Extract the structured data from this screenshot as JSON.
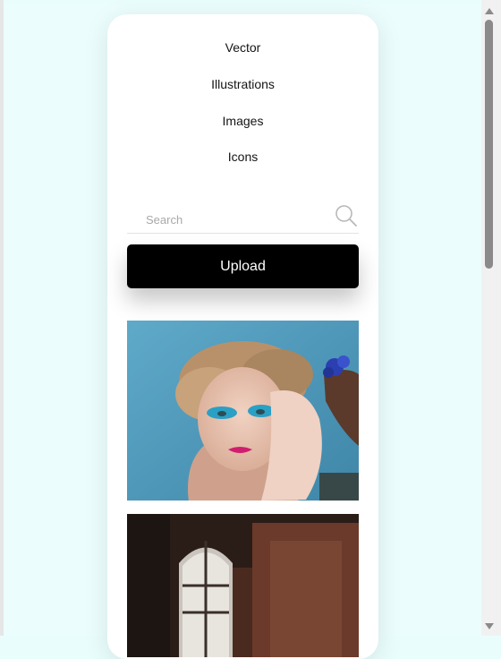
{
  "nav": {
    "items": [
      {
        "label": "Vector"
      },
      {
        "label": "Illustrations"
      },
      {
        "label": "Images"
      },
      {
        "label": "Icons"
      }
    ]
  },
  "search": {
    "placeholder": "Search",
    "value": ""
  },
  "upload": {
    "label": "Upload"
  },
  "gallery": {
    "items": [
      {
        "subject": "portrait-with-blue-eyeshadow"
      },
      {
        "subject": "dark-room-with-arched-window"
      }
    ]
  },
  "colors": {
    "background": "#ebfdfd",
    "card": "#ffffff",
    "upload_button": "#000000",
    "upload_text": "#ffffff"
  }
}
